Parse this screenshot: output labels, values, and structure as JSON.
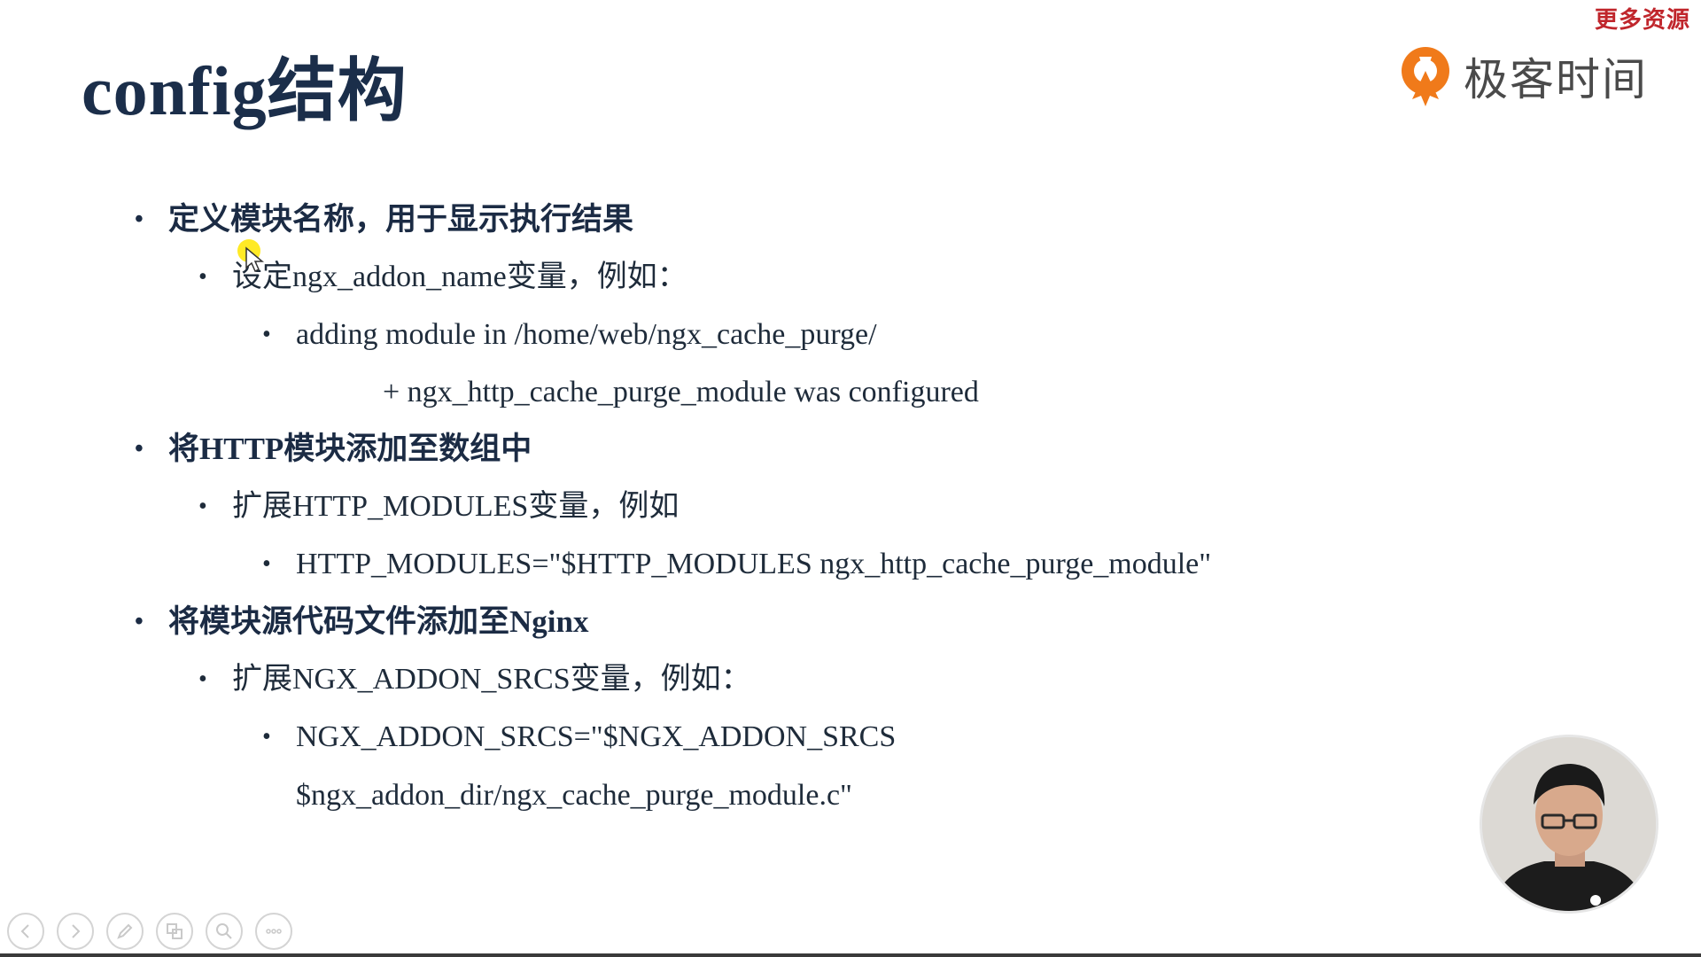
{
  "watermark": "更多资源",
  "slide": {
    "title": "config结构",
    "logo_text": "极客时间",
    "items": [
      {
        "level": 1,
        "text": "定义模块名称，用于显示执行结果"
      },
      {
        "level": 2,
        "text": "设定ngx_addon_name变量，例如："
      },
      {
        "level": 3,
        "text": "adding module in /home/web/ngx_cache_purge/"
      },
      {
        "level": "cont",
        "text": "+ ngx_http_cache_purge_module was configured"
      },
      {
        "level": 1,
        "text": "将HTTP模块添加至数组中"
      },
      {
        "level": 2,
        "text": "扩展HTTP_MODULES变量，例如"
      },
      {
        "level": 3,
        "text": "HTTP_MODULES=\"$HTTP_MODULES ngx_http_cache_purge_module\""
      },
      {
        "level": 1,
        "text": "将模块源代码文件添加至Nginx"
      },
      {
        "level": 2,
        "text": "扩展NGX_ADDON_SRCS变量，例如："
      },
      {
        "level": 3,
        "text": "NGX_ADDON_SRCS=\"$NGX_ADDON_SRCS"
      },
      {
        "level": "cont2",
        "text": "$ngx_addon_dir/ngx_cache_purge_module.c\""
      }
    ],
    "bullet": "•"
  },
  "toolbar": {
    "buttons": [
      "previous-icon",
      "next-icon",
      "pen-icon",
      "slides-icon",
      "zoom-icon",
      "more-icon"
    ]
  },
  "colors": {
    "title": "#1b2e4a",
    "logo_orange": "#f07a1a",
    "watermark": "#c0262c",
    "cursor_highlight": "#ffe600"
  }
}
